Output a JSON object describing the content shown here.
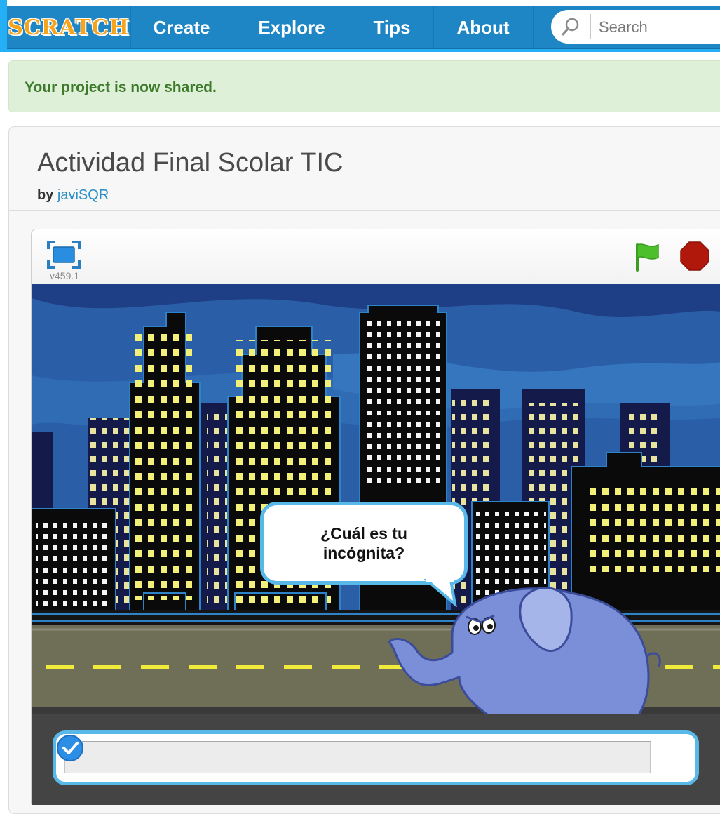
{
  "nav": {
    "logo": "SCRATCH",
    "items": [
      {
        "label": "Create"
      },
      {
        "label": "Explore"
      },
      {
        "label": "Tips"
      },
      {
        "label": "About"
      }
    ],
    "search": {
      "placeholder": "Search",
      "icon": "search-icon"
    }
  },
  "banner": {
    "message": "Your project is now shared."
  },
  "project": {
    "title": "Actividad Final Scolar TIC",
    "by_prefix": "by",
    "author": "javiSQR"
  },
  "player": {
    "version": "v459.1",
    "icons": {
      "fullscreen": "fullscreen-icon",
      "green_flag": "green-flag-icon",
      "stop": "stop-icon"
    },
    "speech": "¿Cuál es tu incógnita?",
    "answer_value": ""
  },
  "colors": {
    "nav_bg": "#1f86c6",
    "banner_bg": "#dff0d8",
    "banner_text": "#3d7a2c",
    "link": "#2a8ec6",
    "flag": "#4cbf2a",
    "stop": "#b0180c",
    "bubble_border": "#58b8e8"
  }
}
